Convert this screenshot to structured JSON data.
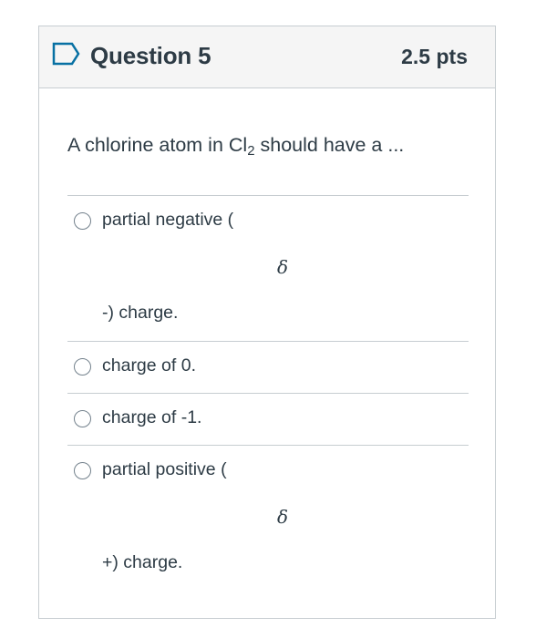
{
  "question": {
    "title": "Question 5",
    "points": "2.5 pts",
    "prompt_before": "A chlorine atom in Cl",
    "prompt_sub": "2",
    "prompt_after": " should have a ..."
  },
  "answers": [
    {
      "text": "partial negative (",
      "symbol": "δ",
      "tail": "-) charge."
    },
    {
      "text": "charge of 0."
    },
    {
      "text": "charge of -1."
    },
    {
      "text": "partial positive (",
      "symbol": "δ",
      "tail": "+)  charge."
    }
  ],
  "colors": {
    "text": "#2d3b45",
    "border": "#c7cdd1",
    "header_bg": "#f5f5f5",
    "flag_icon": "#0770a3",
    "radio_border": "#73818c"
  }
}
